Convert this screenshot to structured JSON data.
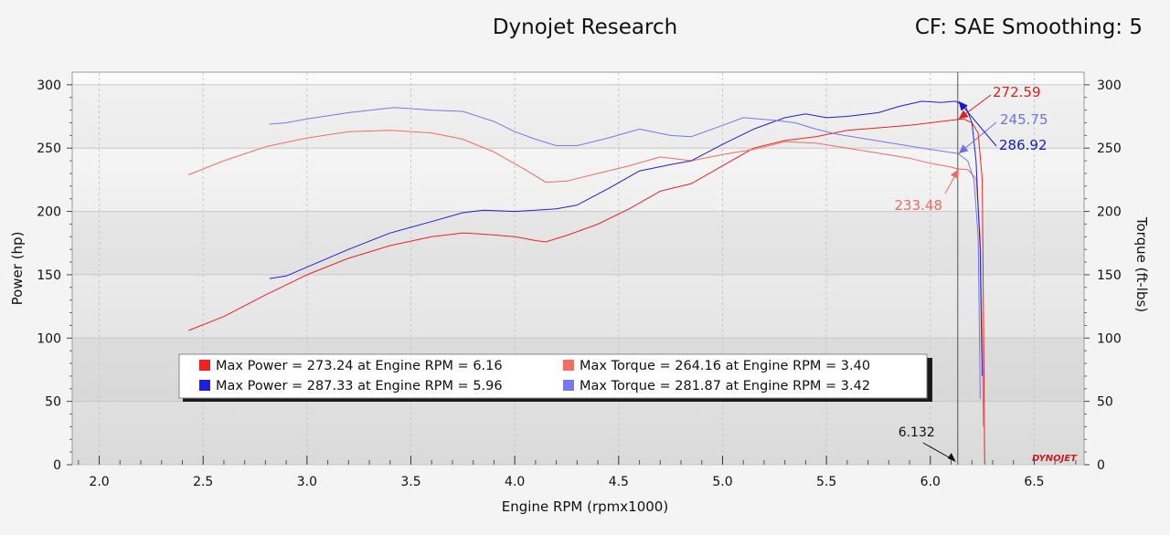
{
  "header": {
    "title": "Dynojet Research",
    "right_label": "CF: SAE Smoothing: 5"
  },
  "logo_text": "DYNOJET",
  "chart_data": {
    "type": "line",
    "xlabel": "Engine RPM (rpmx1000)",
    "ylabel_left": "Power (hp)",
    "ylabel_right": "Torque (ft-lbs)",
    "xlim": [
      1.87,
      6.74
    ],
    "ylim": [
      0,
      310
    ],
    "x_ticks": [
      "2.0",
      "2.5",
      "3.0",
      "3.5",
      "4.0",
      "4.5",
      "5.0",
      "5.5",
      "6.0",
      "6.5"
    ],
    "y_ticks": [
      "0",
      "50",
      "100",
      "150",
      "200",
      "250",
      "300"
    ],
    "grid": true,
    "marker": {
      "x": 6.132,
      "label": "6.132"
    },
    "colors": {
      "red_power": "#ec2323",
      "red_torque": "#f26d62",
      "blue_power": "#1f1fd6",
      "blue_torque": "#7777ee"
    },
    "series": [
      {
        "key": "red_power",
        "color": "#ec2323",
        "points": [
          [
            2.43,
            106
          ],
          [
            2.6,
            117
          ],
          [
            2.8,
            134
          ],
          [
            3.0,
            150
          ],
          [
            3.2,
            163
          ],
          [
            3.4,
            173
          ],
          [
            3.6,
            180
          ],
          [
            3.75,
            183
          ],
          [
            3.85,
            182
          ],
          [
            4.0,
            180
          ],
          [
            4.1,
            177
          ],
          [
            4.15,
            176
          ],
          [
            4.25,
            181
          ],
          [
            4.4,
            190
          ],
          [
            4.55,
            202
          ],
          [
            4.7,
            216
          ],
          [
            4.85,
            222
          ],
          [
            5.0,
            236
          ],
          [
            5.15,
            250
          ],
          [
            5.3,
            256
          ],
          [
            5.45,
            259
          ],
          [
            5.6,
            264
          ],
          [
            5.75,
            266
          ],
          [
            5.9,
            268
          ],
          [
            6.0,
            270
          ],
          [
            6.1,
            272
          ],
          [
            6.16,
            273
          ],
          [
            6.2,
            270
          ],
          [
            6.23,
            262
          ],
          [
            6.25,
            225
          ],
          [
            6.255,
            130
          ],
          [
            6.26,
            30
          ],
          [
            6.262,
            0
          ]
        ]
      },
      {
        "key": "red_torque",
        "color": "#f26d62",
        "points": [
          [
            2.43,
            229
          ],
          [
            2.6,
            240
          ],
          [
            2.8,
            251
          ],
          [
            3.0,
            258
          ],
          [
            3.2,
            263
          ],
          [
            3.4,
            264
          ],
          [
            3.6,
            262
          ],
          [
            3.75,
            257
          ],
          [
            3.9,
            247
          ],
          [
            4.05,
            233
          ],
          [
            4.15,
            223
          ],
          [
            4.25,
            224
          ],
          [
            4.4,
            230
          ],
          [
            4.55,
            236
          ],
          [
            4.7,
            243
          ],
          [
            4.85,
            240
          ],
          [
            5.0,
            245
          ],
          [
            5.15,
            249
          ],
          [
            5.3,
            255
          ],
          [
            5.45,
            254
          ],
          [
            5.6,
            250
          ],
          [
            5.75,
            246
          ],
          [
            5.9,
            242
          ],
          [
            6.0,
            238
          ],
          [
            6.1,
            235
          ],
          [
            6.132,
            233.48
          ],
          [
            6.18,
            233
          ],
          [
            6.22,
            226
          ],
          [
            6.24,
            180
          ],
          [
            6.25,
            100
          ],
          [
            6.255,
            30
          ]
        ]
      },
      {
        "key": "blue_power",
        "color": "#1f1fd6",
        "points": [
          [
            2.82,
            147
          ],
          [
            2.9,
            149
          ],
          [
            3.0,
            156
          ],
          [
            3.2,
            170
          ],
          [
            3.4,
            183
          ],
          [
            3.6,
            192
          ],
          [
            3.75,
            199
          ],
          [
            3.85,
            201
          ],
          [
            4.0,
            200
          ],
          [
            4.1,
            201
          ],
          [
            4.2,
            202
          ],
          [
            4.3,
            205
          ],
          [
            4.45,
            218
          ],
          [
            4.6,
            232
          ],
          [
            4.75,
            237
          ],
          [
            4.85,
            240
          ],
          [
            5.0,
            253
          ],
          [
            5.15,
            265
          ],
          [
            5.3,
            274
          ],
          [
            5.4,
            277
          ],
          [
            5.5,
            274
          ],
          [
            5.6,
            275
          ],
          [
            5.75,
            278
          ],
          [
            5.85,
            283
          ],
          [
            5.96,
            287
          ],
          [
            6.05,
            286
          ],
          [
            6.12,
            287
          ],
          [
            6.17,
            283
          ],
          [
            6.2,
            270
          ],
          [
            6.22,
            240
          ],
          [
            6.24,
            170
          ],
          [
            6.245,
            110
          ],
          [
            6.25,
            70
          ]
        ]
      },
      {
        "key": "blue_torque",
        "color": "#7777ee",
        "points": [
          [
            2.82,
            269
          ],
          [
            2.9,
            270
          ],
          [
            3.0,
            273
          ],
          [
            3.2,
            278
          ],
          [
            3.42,
            282
          ],
          [
            3.6,
            280
          ],
          [
            3.75,
            279
          ],
          [
            3.9,
            271
          ],
          [
            4.0,
            263
          ],
          [
            4.1,
            257
          ],
          [
            4.2,
            252
          ],
          [
            4.3,
            252
          ],
          [
            4.45,
            258
          ],
          [
            4.6,
            265
          ],
          [
            4.75,
            260
          ],
          [
            4.85,
            259
          ],
          [
            5.0,
            268
          ],
          [
            5.1,
            274
          ],
          [
            5.25,
            272
          ],
          [
            5.35,
            270
          ],
          [
            5.45,
            265
          ],
          [
            5.55,
            261
          ],
          [
            5.7,
            257
          ],
          [
            5.85,
            253
          ],
          [
            6.0,
            249
          ],
          [
            6.132,
            245.75
          ],
          [
            6.18,
            240
          ],
          [
            6.21,
            225
          ],
          [
            6.23,
            180
          ],
          [
            6.235,
            120
          ],
          [
            6.24,
            60
          ],
          [
            6.24,
            52
          ]
        ]
      }
    ],
    "value_labels": [
      {
        "text": "272.59",
        "color": "#e01f1f",
        "series": "red_power"
      },
      {
        "text": "245.75",
        "color": "#7070e6",
        "series": "blue_torque"
      },
      {
        "text": "286.92",
        "color": "#1a1ac8",
        "series": "blue_power"
      },
      {
        "text": "233.48",
        "color": "#ef6a60",
        "series": "red_torque"
      }
    ],
    "legend": {
      "placement": "bottom-left",
      "entries": [
        {
          "color": "#ec2323",
          "text": "Max Power = 273.24 at Engine RPM = 6.16"
        },
        {
          "color": "#f26d62",
          "text": "Max Torque = 264.16 at Engine RPM = 3.40"
        },
        {
          "color": "#1f1fd6",
          "text": "Max Power = 287.33 at Engine RPM = 5.96"
        },
        {
          "color": "#7777ee",
          "text": "Max Torque = 281.87 at Engine RPM = 3.42"
        }
      ]
    }
  }
}
